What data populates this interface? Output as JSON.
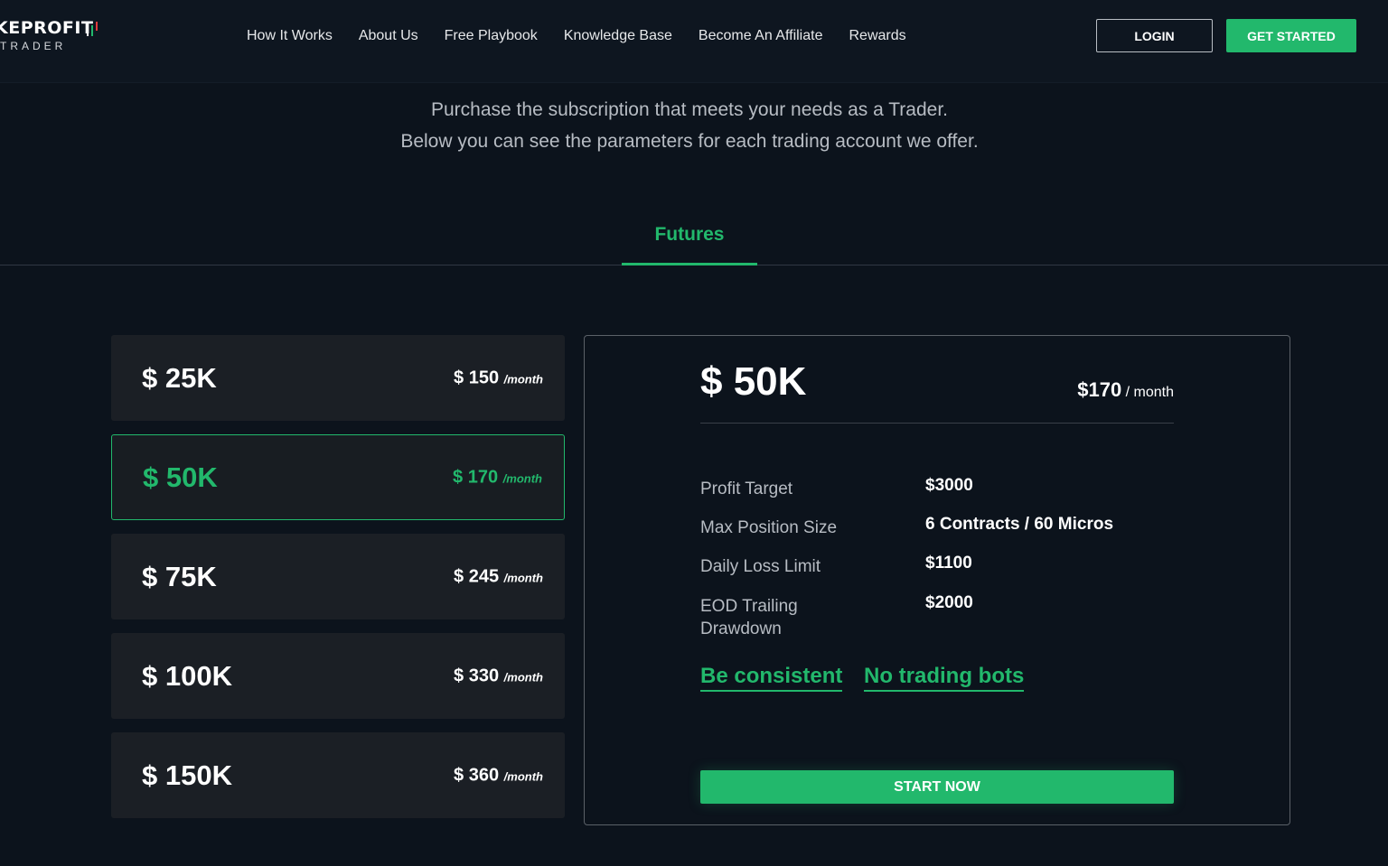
{
  "header": {
    "logo_top": "KEPROFIT",
    "logo_bottom": "TRADER",
    "nav": [
      "How It Works",
      "About Us",
      "Free Playbook",
      "Knowledge Base",
      "Become An Affiliate",
      "Rewards"
    ],
    "login_label": "LOGIN",
    "get_started_label": "GET STARTED"
  },
  "intro": {
    "line1": "Purchase the subscription that meets your needs as a Trader.",
    "line2": "Below you can see the parameters for each trading account we offer."
  },
  "tabs": {
    "active": "Futures"
  },
  "plans": [
    {
      "size": "$ 25K",
      "price": "$ 150",
      "per": "/month",
      "selected": false
    },
    {
      "size": "$ 50K",
      "price": "$ 170",
      "per": "/month",
      "selected": true
    },
    {
      "size": "$ 75K",
      "price": "$ 245",
      "per": "/month",
      "selected": false
    },
    {
      "size": "$ 100K",
      "price": "$ 330",
      "per": "/month",
      "selected": false
    },
    {
      "size": "$ 150K",
      "price": "$ 360",
      "per": "/month",
      "selected": false
    }
  ],
  "detail": {
    "size": "$ 50K",
    "price_amount": "$170",
    "price_per": "/ month",
    "params": [
      {
        "label": "Profit Target",
        "value": "$3000"
      },
      {
        "label": "Max Position Size",
        "value": "6 Contracts / 60 Micros"
      },
      {
        "label": "Daily Loss Limit",
        "value": "$1100"
      },
      {
        "label": "EOD Trailing Drawdown",
        "value": "$2000"
      }
    ],
    "rules": [
      "Be consistent",
      "No trading bots"
    ],
    "cta_label": "START NOW"
  },
  "colors": {
    "accent": "#22b86c",
    "background": "#0c131c",
    "card": "#1b1f25",
    "text_muted": "#b7bcc3"
  }
}
